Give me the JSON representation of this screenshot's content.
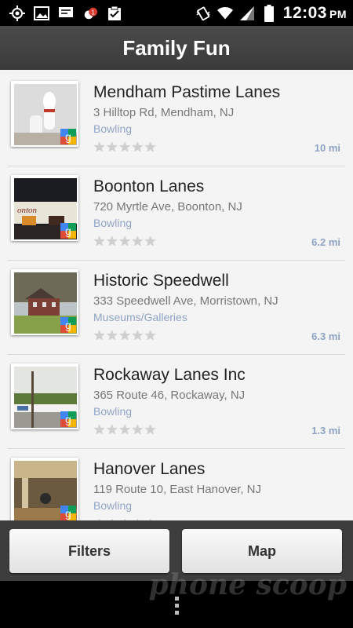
{
  "status_bar": {
    "icons": [
      "gps-icon",
      "image-icon",
      "message-icon",
      "notification-badge-icon",
      "checklist-icon",
      "vibrate-icon",
      "wifi-icon",
      "signal-icon",
      "battery-icon"
    ],
    "notification_count": "1",
    "time": "12:03",
    "ampm": "PM"
  },
  "header": {
    "title": "Family Fun"
  },
  "places": [
    {
      "name": "Mendham Pastime Lanes",
      "address": "3 Hilltop Rd, Mendham, NJ",
      "category": "Bowling",
      "rating": 0,
      "distance": "10 mi"
    },
    {
      "name": "Boonton Lanes",
      "address": "720 Myrtle Ave, Boonton, NJ",
      "category": "Bowling",
      "rating": 0,
      "distance": "6.2 mi"
    },
    {
      "name": "Historic Speedwell",
      "address": "333 Speedwell Ave, Morristown, NJ",
      "category": "Museums/Galleries",
      "rating": 0,
      "distance": "6.3 mi"
    },
    {
      "name": "Rockaway Lanes Inc",
      "address": "365 Route 46, Rockaway, NJ",
      "category": "Bowling",
      "rating": 0,
      "distance": "1.3 mi"
    },
    {
      "name": "Hanover Lanes",
      "address": "119 Route 10, East Hanover, NJ",
      "category": "Bowling",
      "rating": 0,
      "distance": ""
    }
  ],
  "buttons": {
    "filters": "Filters",
    "map": "Map"
  },
  "watermark": "phone scoop",
  "colors": {
    "header_bg": "#444444",
    "category_text": "#8fa4c4",
    "list_bg": "#f4f4f4"
  }
}
